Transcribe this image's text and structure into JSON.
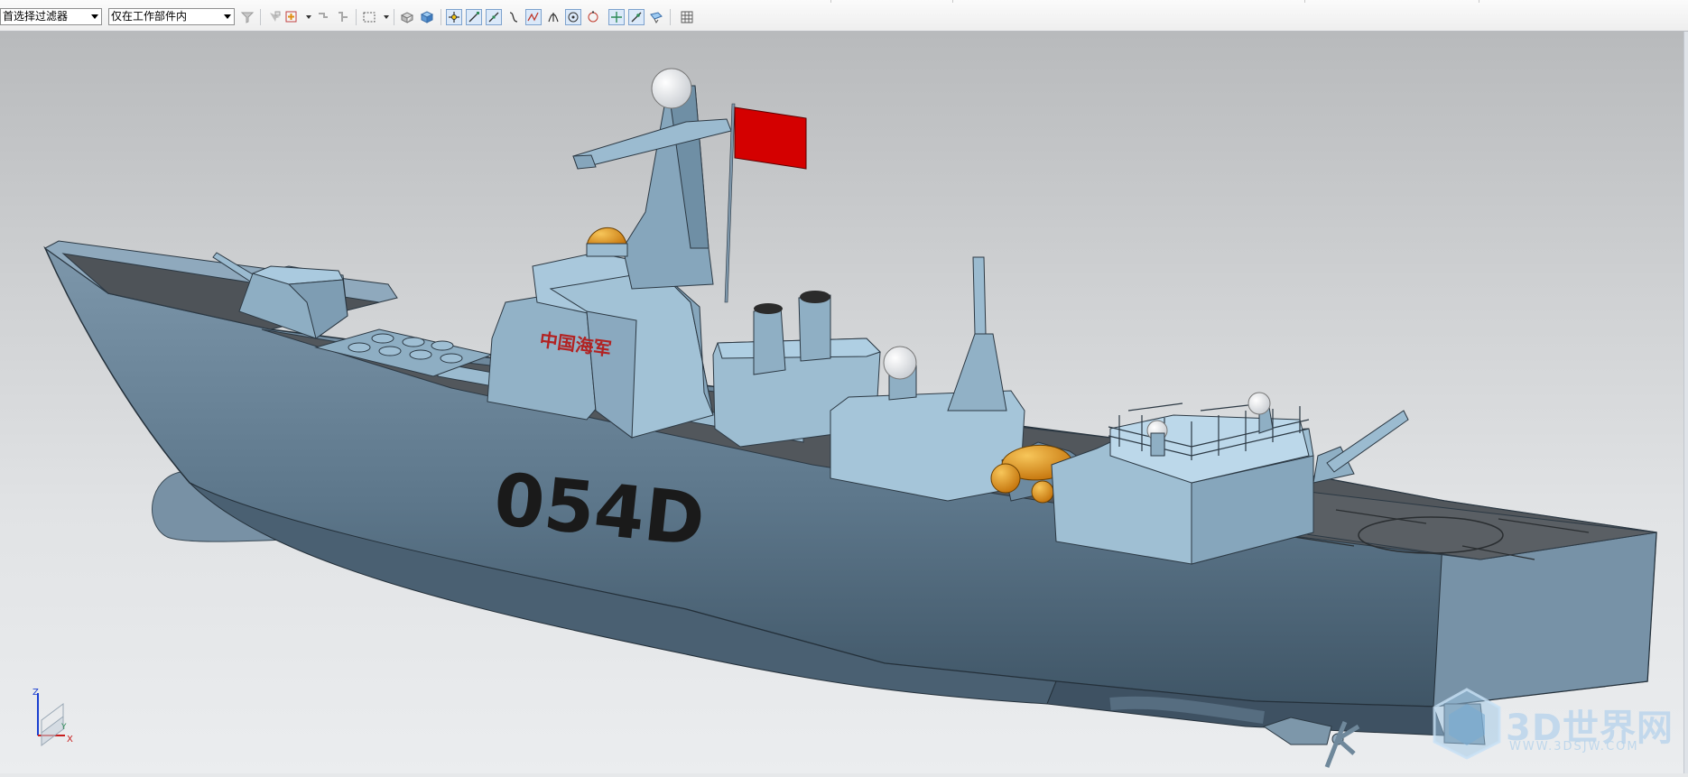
{
  "toolbar": {
    "filter_dropdown": {
      "value": "首选择过滤器"
    },
    "scope_dropdown": {
      "value": "仅在工作部件内"
    },
    "icons": [
      "filter-icon",
      "add-selection-icon",
      "deselect-icon",
      "select-feature-icon",
      "rectangle-select-icon",
      "view-box-icon",
      "shaded-cube-icon",
      "snap-point-icon",
      "line-icon",
      "arc-icon",
      "spline-icon",
      "midpoint-icon",
      "intersection-icon",
      "center-point-icon",
      "quadrant-icon",
      "pole-icon",
      "point-on-curve-icon",
      "face-icon",
      "grid-icon"
    ]
  },
  "model": {
    "hull_number": "054D",
    "ship_label": "中国海军",
    "colors": {
      "hull": "#6f8a9e",
      "superstructure": "#9bbbd0",
      "deck": "#4e5358",
      "flag": "#d40000",
      "orange": "#e08d12"
    }
  },
  "triad": {
    "z_label": "Z",
    "y_label": "Y",
    "x_label": "X"
  },
  "watermark": {
    "text": "3D世界网",
    "url": "WWW.3DSJW.COM"
  }
}
